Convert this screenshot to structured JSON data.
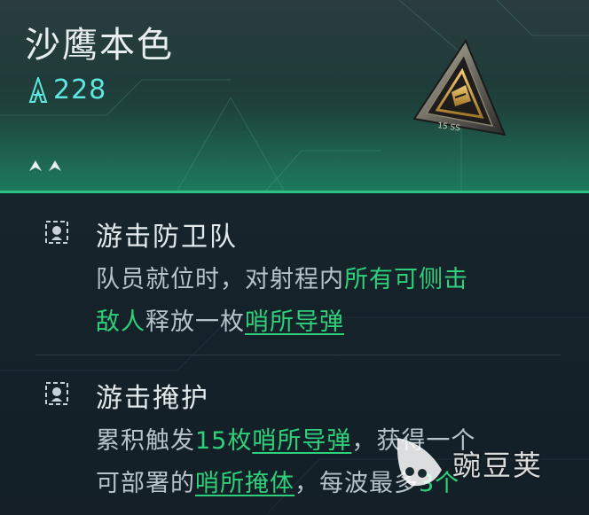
{
  "item": {
    "name": "沙鹰本色",
    "power_value": "228",
    "rank_stars": 2
  },
  "skills": [
    {
      "name": "游击防卫队",
      "desc_line1_a": "队员就位时，对射程内",
      "desc_line1_b": "所有可侧击",
      "desc_line2_a": "敌人",
      "desc_line2_b": "释放一枚",
      "desc_line2_c": "哨所导弹"
    },
    {
      "name": "游击掩护",
      "desc_line1_a": "累积触发",
      "desc_line1_b": "15枚",
      "desc_line1_c": "哨所导弹",
      "desc_line1_d": "，获得一个",
      "desc_line2_a": "可部署的",
      "desc_line2_b": "哨所掩体",
      "desc_line2_c": "，每波最多",
      "desc_line2_d": "3个"
    }
  ],
  "watermark": {
    "text": "豌豆荚"
  },
  "colors": {
    "accent_green": "#2fd07a",
    "power_cyan": "#5ee6e0",
    "header_border": "#2bbf83"
  }
}
